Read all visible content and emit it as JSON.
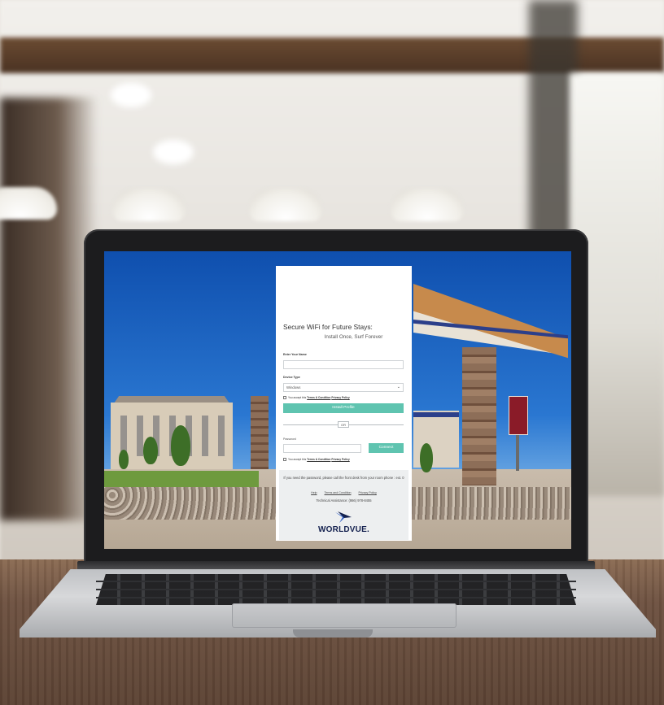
{
  "card": {
    "title": "Secure WiFi for Future Stays:",
    "subtitle": "Install Once, Surf Forever",
    "name_label": "Enter Your Name",
    "name_value": "",
    "device_label": "Device Type",
    "device_selected": "Windows",
    "terms_prefix": "You accept this",
    "terms_link": "Terms & Condition",
    "privacy_link": "Privacy Policy",
    "install_button": "Install Profile",
    "or_text": "OR",
    "password_label": "Password",
    "password_value": "",
    "connect_button": "Connect",
    "terms_prefix_2": "You accept this",
    "terms_link_2": "Terms & Condition",
    "privacy_link_2": "Privacy Policy"
  },
  "footer": {
    "message": "If you need the password, please call the front desk from your room phone : ext. 0",
    "help_link": "Help",
    "terms_link": "Terms and Condition",
    "privacy_link": "Privacy Policy",
    "tech_assistance": "Technical Assistance: (866) 978-8455",
    "logo_text": "WORLDVUE."
  },
  "colors": {
    "button": "#5fc4b0",
    "brand_navy": "#14214f",
    "brand_blue": "#2f5fc6"
  },
  "icons": {
    "device_dropdown": "chevron-down-icon",
    "logo": "worldvue-bird-logo"
  }
}
